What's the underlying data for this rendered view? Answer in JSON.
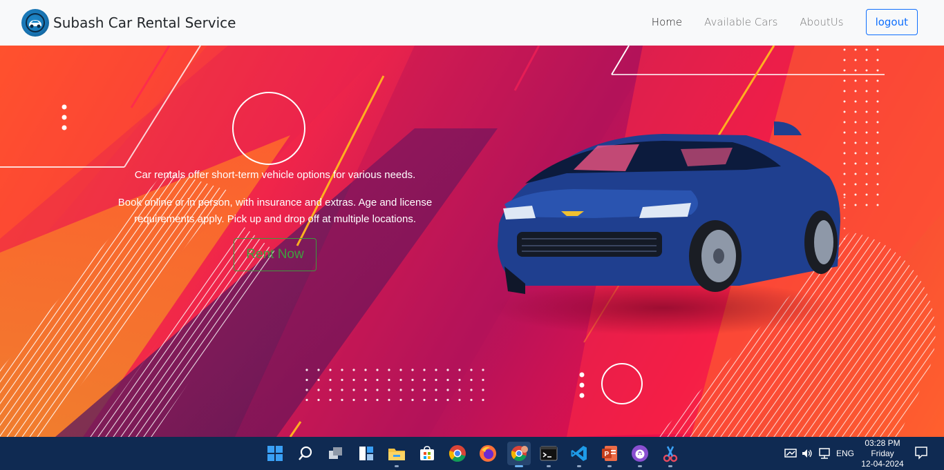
{
  "navbar": {
    "brand": "Subash Car Rental Service",
    "links": [
      "Home",
      "Available Cars",
      "AboutUs"
    ],
    "logout_label": "logout"
  },
  "hero": {
    "line1": "Car rentals offer short-term vehicle options for various needs.",
    "line2": "Book online or in person, with insurance and extras. Age and license requirements apply. Pick up and drop off at multiple locations.",
    "cta_label": "Rent Now",
    "car_color": "#1f3f8f"
  },
  "taskbar": {
    "language": "ENG",
    "time": "03:28 PM",
    "day": "Friday",
    "date": "12-04-2024",
    "apps": [
      "start-icon",
      "search-icon",
      "task-view-icon",
      "widgets-icon",
      "file-explorer-icon",
      "store-icon",
      "chrome-icon",
      "firefox-icon",
      "chrome-profile-icon",
      "terminal-icon",
      "vscode-icon",
      "powerpoint-icon",
      "github-desktop-icon",
      "snipping-tool-icon"
    ]
  },
  "colors": {
    "primary": "#0d6efd",
    "cta": "#3fa03f",
    "taskbar": "#0f2a52"
  }
}
